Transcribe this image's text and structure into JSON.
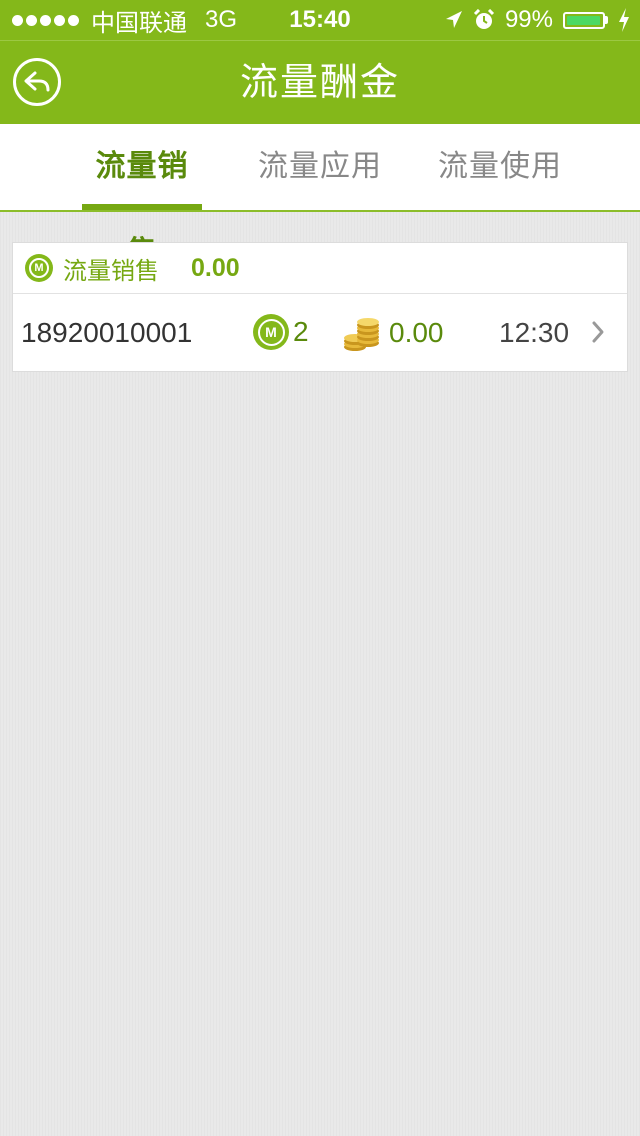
{
  "status_bar": {
    "carrier": "中国联通",
    "network": "3G",
    "time": "15:40",
    "battery": "99%"
  },
  "nav": {
    "title": "流量酬金"
  },
  "tabs": [
    {
      "label": "流量销售",
      "active": true
    },
    {
      "label": "流量应用",
      "active": false
    },
    {
      "label": "流量使用",
      "active": false
    }
  ],
  "summary": {
    "label": "流量销售",
    "total": "0.00"
  },
  "records": [
    {
      "phone": "18920010001",
      "count": "2",
      "amount": "0.00",
      "time": "12:30"
    }
  ],
  "colors": {
    "brand_green": "#84b81a",
    "accent_green": "#76a812",
    "battery_green": "#4cd964"
  }
}
